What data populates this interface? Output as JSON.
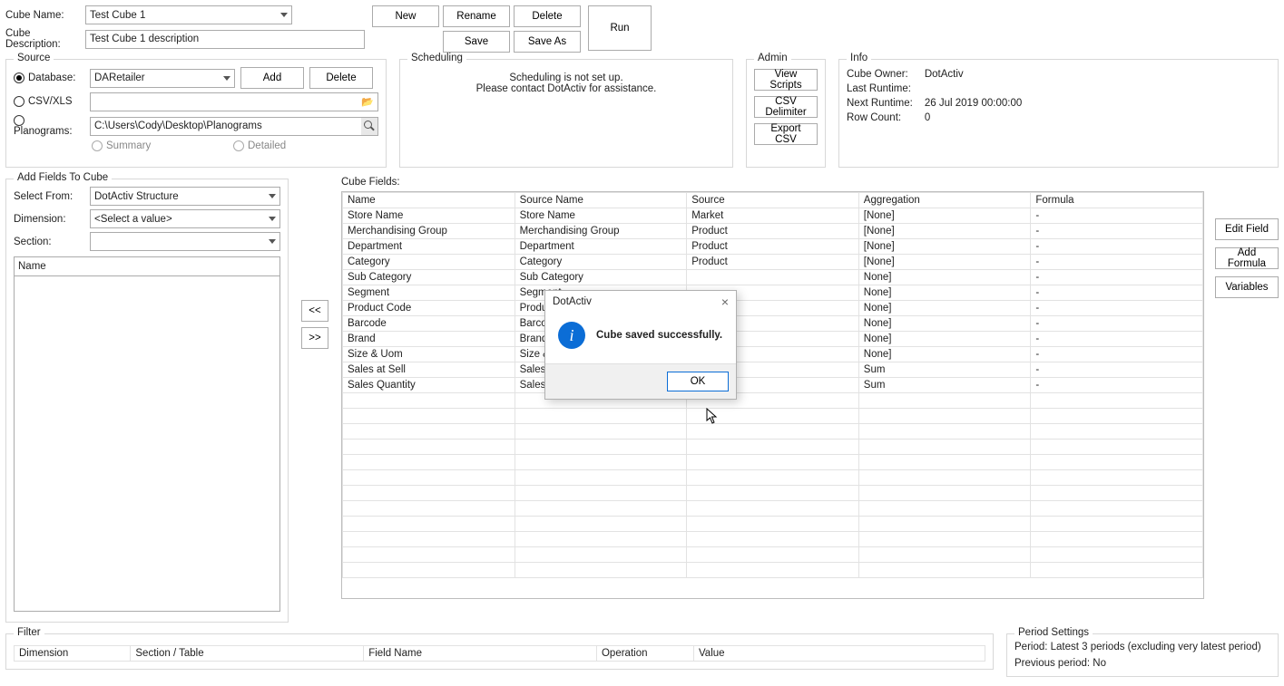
{
  "top": {
    "cube_name_label": "Cube Name:",
    "cube_name_value": "Test Cube 1",
    "cube_desc_label": "Cube Description:",
    "cube_desc_value": "Test Cube 1 description",
    "new_btn": "New",
    "rename_btn": "Rename",
    "delete_btn": "Delete",
    "save_btn": "Save",
    "saveas_btn": "Save As",
    "run_btn": "Run"
  },
  "source": {
    "legend": "Source",
    "database_label": "Database:",
    "database_value": "DARetailer",
    "csv_label": "CSV/XLS",
    "plan_label": "Planograms:",
    "plan_value": "C:\\Users\\Cody\\Desktop\\Planograms",
    "add_btn": "Add",
    "delete_btn": "Delete",
    "summary": "Summary",
    "detailed": "Detailed"
  },
  "scheduling": {
    "legend": "Scheduling",
    "line1": "Scheduling is not set up.",
    "line2": "Please contact DotActiv for assistance."
  },
  "admin": {
    "legend": "Admin",
    "view_scripts": "View Scripts",
    "csv_delim": "CSV Delimiter",
    "export_csv": "Export CSV"
  },
  "info": {
    "legend": "Info",
    "owner_label": "Cube Owner:",
    "owner_value": "DotActiv",
    "last_label": "Last Runtime:",
    "last_value": "",
    "next_label": "Next Runtime:",
    "next_value": "26 Jul 2019 00:00:00",
    "row_label": "Row Count:",
    "row_value": "0"
  },
  "addfields": {
    "legend": "Add Fields To Cube",
    "select_from_label": "Select From:",
    "select_from_value": "DotActiv Structure",
    "dimension_label": "Dimension:",
    "dimension_value": "<Select a value>",
    "section_label": "Section:",
    "name_header": "Name",
    "move_left": "<<",
    "move_right": ">>"
  },
  "cube_fields": {
    "label": "Cube Fields:",
    "headers": {
      "name": "Name",
      "source_name": "Source Name",
      "source": "Source",
      "aggregation": "Aggregation",
      "formula": "Formula"
    },
    "edit_field": "Edit Field",
    "add_formula": "Add Formula",
    "variables": "Variables",
    "rows": [
      {
        "name": "Store Name",
        "source_name": "Store Name",
        "source": "Market",
        "agg": "[None]",
        "formula": "-"
      },
      {
        "name": "Merchandising Group",
        "source_name": "Merchandising Group",
        "source": "Product",
        "agg": "[None]",
        "formula": "-"
      },
      {
        "name": "Department",
        "source_name": "Department",
        "source": "Product",
        "agg": "[None]",
        "formula": "-"
      },
      {
        "name": "Category",
        "source_name": "Category",
        "source": "Product",
        "agg": "[None]",
        "formula": "-"
      },
      {
        "name": "Sub Category",
        "source_name": "Sub Category",
        "source": "",
        "agg": "None]",
        "formula": "-"
      },
      {
        "name": "Segment",
        "source_name": "Segment",
        "source": "",
        "agg": "None]",
        "formula": "-"
      },
      {
        "name": "Product Code",
        "source_name": "Product Code",
        "source": "",
        "agg": "None]",
        "formula": "-"
      },
      {
        "name": "Barcode",
        "source_name": "Barcode",
        "source": "",
        "agg": "None]",
        "formula": "-"
      },
      {
        "name": "Brand",
        "source_name": "Brand",
        "source": "",
        "agg": "None]",
        "formula": "-"
      },
      {
        "name": "Size & Uom",
        "source_name": "Size & Uom",
        "source": "",
        "agg": "None]",
        "formula": "-"
      },
      {
        "name": "Sales at Sell",
        "source_name": "Sales at Sell",
        "source": "",
        "agg": "Sum",
        "formula": "-"
      },
      {
        "name": "Sales Quantity",
        "source_name": "Sales Quantity",
        "source": "",
        "agg": "Sum",
        "formula": "-"
      }
    ]
  },
  "filter": {
    "legend": "Filter",
    "headers": {
      "dimension": "Dimension",
      "section": "Section / Table",
      "field": "Field Name",
      "operation": "Operation",
      "value": "Value"
    }
  },
  "period": {
    "legend": "Period Settings",
    "line1": "Period: Latest 3 periods (excluding very latest period)",
    "line2": "Previous period: No"
  },
  "dialog": {
    "title": "DotActiv",
    "msg": "Cube saved successfully.",
    "ok": "OK",
    "close": "×"
  }
}
